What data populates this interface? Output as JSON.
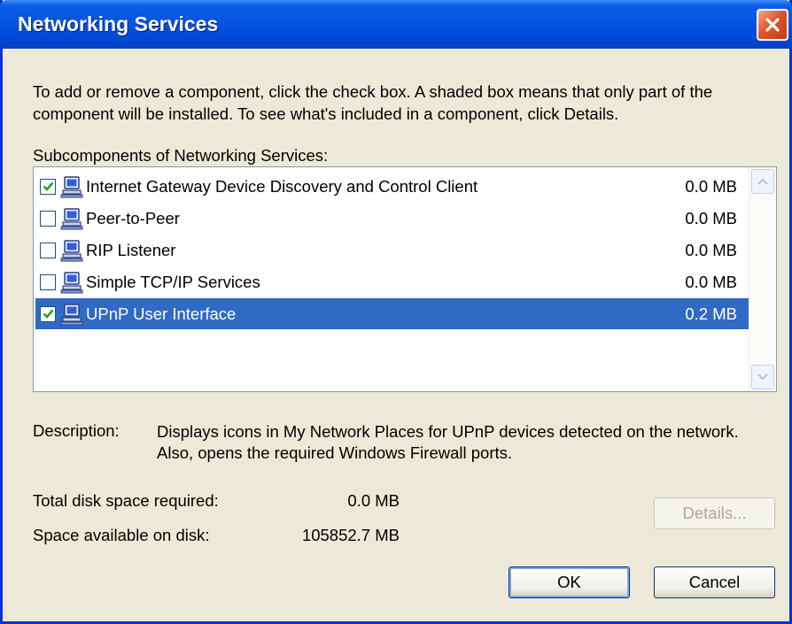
{
  "window": {
    "title": "Networking Services"
  },
  "intro": "To add or remove a component, click the check box. A shaded box means that only part of the component will be installed. To see what's included in a component, click Details.",
  "subcomponents_label": "Subcomponents of Networking Services:",
  "components": [
    {
      "name": "Internet Gateway Device Discovery and Control Client",
      "size": "0.0 MB",
      "checked": true,
      "selected": false
    },
    {
      "name": "Peer-to-Peer",
      "size": "0.0 MB",
      "checked": false,
      "selected": false
    },
    {
      "name": "RIP Listener",
      "size": "0.0 MB",
      "checked": false,
      "selected": false
    },
    {
      "name": "Simple TCP/IP Services",
      "size": "0.0 MB",
      "checked": false,
      "selected": false
    },
    {
      "name": "UPnP User Interface",
      "size": "0.2 MB",
      "checked": true,
      "selected": true
    }
  ],
  "description": {
    "label": "Description:",
    "text": "Displays icons in My Network Places for UPnP devices detected on the network. Also, opens the required Windows Firewall ports."
  },
  "disk": {
    "total_label": "Total disk space required:",
    "total_value": "0.0 MB",
    "available_label": "Space available on disk:",
    "available_value": "105852.7 MB"
  },
  "buttons": {
    "details": "Details...",
    "ok": "OK",
    "cancel": "Cancel"
  },
  "colors": {
    "titlebar": "#0553e0",
    "selection": "#316ac5",
    "dialog_bg": "#ece9d8",
    "close": "#e1562f"
  }
}
